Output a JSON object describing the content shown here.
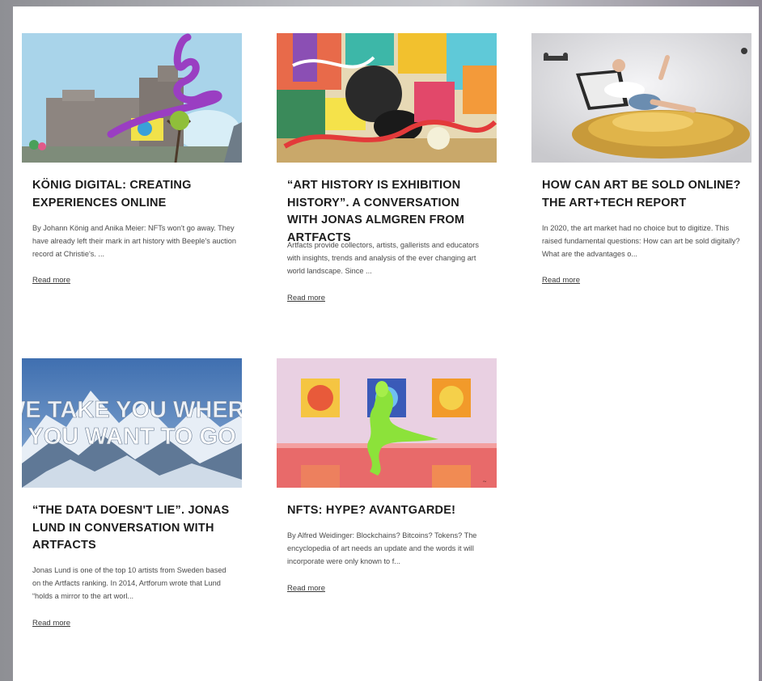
{
  "articles": [
    {
      "title": "KÖNIG DIGITAL: CREATING EXPERIENCES ONLINE",
      "excerpt": "By Johann König and Anika Meier: NFTs won't go away. They have already left their mark in art history with Beeple's auction record at Christie's. ...",
      "read_more": "Read more"
    },
    {
      "title": "“ART HISTORY IS EXHIBITION HISTORY”. A CONVERSATION WITH JONAS ALMGREN FROM ARTFACTS",
      "excerpt": "Artfacts provide collectors, artists, gallerists and educators with insights, trends and analysis of the ever changing art world landscape. Since ...",
      "read_more": "Read more"
    },
    {
      "title": "HOW CAN ART BE SOLD ONLINE? THE ART+TECH REPORT",
      "excerpt": "In 2020, the art market had no choice but to digitize. This raised fundamental questions: How can art be sold digitally? What are the advantages o...",
      "read_more": "Read more"
    },
    {
      "title": "“THE DATA DOESN'T LIE”. JONAS LUND IN CONVERSATION WITH ARTFACTS",
      "excerpt": "Jonas Lund is one of the top 10 artists from Sweden based on the Artfacts ranking. In 2014, Artforum wrote that Lund “holds a mirror to the art worl...",
      "read_more": "Read more",
      "image_text_line1": "WE TAKE YOU WHERE",
      "image_text_line2": "YOU WANT TO GO"
    },
    {
      "title": "NFTS: HYPE? AVANTGARDE!",
      "excerpt": "By Alfred Weidinger: Blockchains? Bitcoins? Tokens? The encyclopedia of art needs an update and the words it will incorporate were only known to f...",
      "read_more": "Read more"
    }
  ]
}
